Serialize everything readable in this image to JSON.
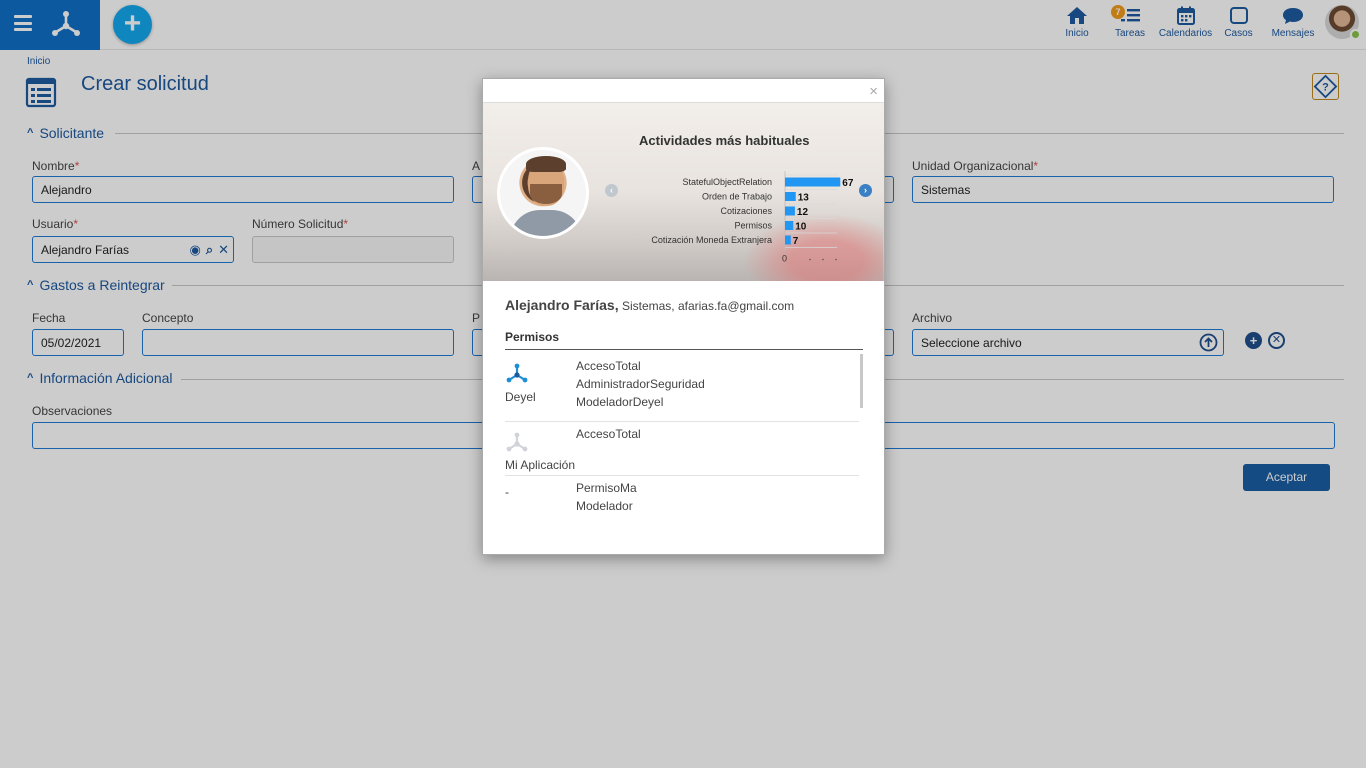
{
  "topbar": {
    "nav": [
      {
        "label": "Inicio",
        "icon": "home-icon"
      },
      {
        "label": "Tareas",
        "icon": "tasks-icon",
        "badge": "7"
      },
      {
        "label": "Calendarios",
        "icon": "calendar-icon"
      },
      {
        "label": "Casos",
        "icon": "cases-icon"
      },
      {
        "label": "Mensajes",
        "icon": "messages-icon"
      }
    ],
    "add_label": "+"
  },
  "page": {
    "breadcrumb": "Inicio",
    "title": "Crear solicitud"
  },
  "sections": {
    "solicitante": "Solicitante",
    "gastos": "Gastos a Reintegrar",
    "info": "Información Adicional"
  },
  "form": {
    "nombre_label": "Nombre",
    "nombre_value": "Alejandro",
    "apellido_label": "A",
    "unidad_label": "Unidad Organizacional",
    "unidad_value": "Sistemas",
    "usuario_label": "Usuario",
    "usuario_value": "Alejandro Farías",
    "numero_label": "Número Solicitud",
    "fecha_label": "Fecha",
    "fecha_value": "05/02/2021",
    "concepto_label": "Concepto",
    "p_label": "P",
    "archivo_label": "Archivo",
    "archivo_value": "Seleccione archivo",
    "observaciones_label": "Observaciones",
    "aceptar_label": "Aceptar"
  },
  "modal": {
    "close": "×",
    "chart_title": "Actividades más habituales",
    "user_name": "Alejandro Farías,",
    "user_details": "Sistemas, afarias.fa@gmail.com",
    "permisos_header": "Permisos",
    "apps": [
      {
        "name": "Deyel",
        "permissions": [
          "AccesoTotal",
          "AdministradorSeguridad",
          "ModeladorDeyel"
        ]
      },
      {
        "name": "Mi Aplicación",
        "permissions": [
          "AccesoTotal"
        ]
      },
      {
        "name": "-",
        "permissions": [
          "PermisoMa",
          "Modelador"
        ]
      }
    ]
  },
  "chart_data": {
    "type": "bar",
    "orientation": "horizontal",
    "title": "Actividades más habituales",
    "categories": [
      "StatefulObjectRelation",
      "Orden de Trabajo",
      "Cotizaciones",
      "Permisos",
      "Cotización Moneda Extranjera"
    ],
    "values": [
      67,
      13,
      12,
      10,
      7
    ],
    "xlim": [
      0,
      80
    ],
    "x_tick_labels": [
      "0"
    ],
    "grid": true,
    "color": "#2196f3"
  },
  "colors": {
    "brand": "#1070c8",
    "accent": "#14a8ef",
    "title": "#1e5aa0",
    "badge": "#f39b1b",
    "button": "#1a5ea3"
  }
}
